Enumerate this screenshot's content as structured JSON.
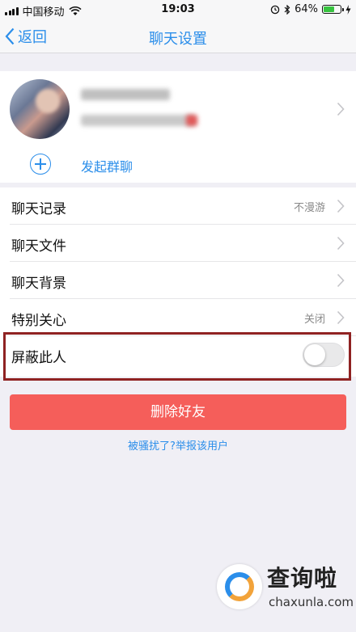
{
  "status_bar": {
    "carrier": "中国移动",
    "time": "19:03",
    "battery_percent": "64%",
    "battery_level": 0.64,
    "icons": [
      "signal-icon",
      "wifi-icon",
      "alarm-icon",
      "bluetooth-icon",
      "battery-icon",
      "charging-icon"
    ]
  },
  "nav": {
    "back_label": "返回",
    "title": "聊天设置"
  },
  "group_chat": {
    "label": "发起群聊"
  },
  "settings": [
    {
      "label": "聊天记录",
      "value": "不漫游"
    },
    {
      "label": "聊天文件",
      "value": ""
    },
    {
      "label": "聊天背景",
      "value": ""
    },
    {
      "label": "特别关心",
      "value": "关闭"
    },
    {
      "label": "屏蔽此人",
      "toggle": false
    }
  ],
  "delete_button": "删除好友",
  "report_link": "被骚扰了?举报该用户",
  "colors": {
    "accent": "#2b8eea",
    "danger": "#f55e5a",
    "highlight_border": "#8f2222",
    "background": "#f0eff5"
  },
  "watermark": {
    "title": "查询啦",
    "url": "chaxunla.com"
  }
}
